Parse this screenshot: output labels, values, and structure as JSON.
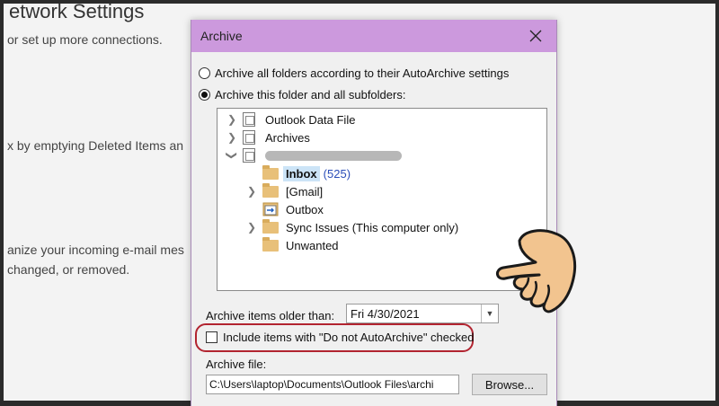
{
  "background_window": {
    "title_fragment": "etwork Settings",
    "lines": [
      "or set up more connections.",
      "x by emptying Deleted Items an",
      "anize your incoming e-mail mes",
      "changed, or removed."
    ]
  },
  "dialog": {
    "title": "Archive",
    "radio_all_label": "Archive all folders according to their AutoArchive settings",
    "radio_this_label": "Archive this folder and all subfolders:",
    "tree": {
      "outlook_data_file": "Outlook Data File",
      "archives": "Archives",
      "inbox": "Inbox",
      "inbox_count": "(525)",
      "gmail": "[Gmail]",
      "outbox": "Outbox",
      "sync_issues": "Sync Issues (This computer only)",
      "unwanted": "Unwanted"
    },
    "older_than_label": "Archive items older than:",
    "older_than_value": "Fri 4/30/2021",
    "include_label": "Include items with \"Do not AutoArchive\" checked",
    "archive_file_label": "Archive file:",
    "archive_file_value": "C:\\Users\\laptop\\Documents\\Outlook Files\\archi",
    "browse_label": "Browse..."
  },
  "colors": {
    "titlebar": "#cc99dd",
    "highlight_ring": "#b22430",
    "selection": "#cce4f7"
  }
}
